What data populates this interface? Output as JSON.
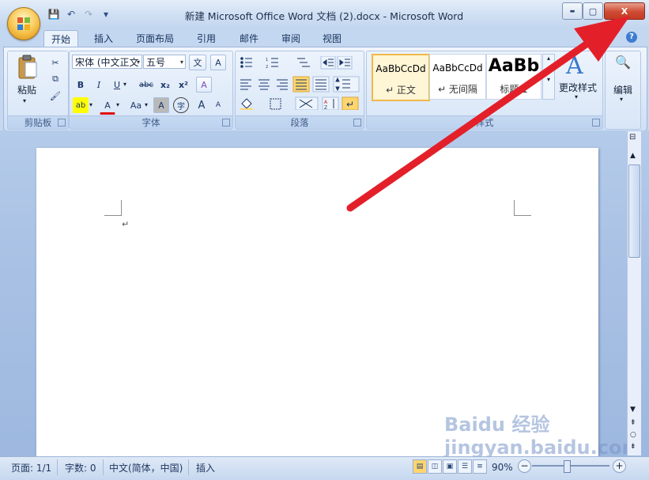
{
  "window": {
    "title": "新建 Microsoft Office Word 文档 (2).docx - Microsoft Word",
    "minimize_symbol": "▬",
    "maximize_symbol": "▢",
    "close_symbol": "X"
  },
  "quick_access": {
    "save_symbol": "💾",
    "undo_symbol": "↶",
    "redo_symbol": "↷",
    "customize_symbol": "▾"
  },
  "tabs": [
    "开始",
    "插入",
    "页面布局",
    "引用",
    "邮件",
    "审阅",
    "视图"
  ],
  "help_symbol": "?",
  "ribbon": {
    "clipboard": {
      "label": "剪贴板",
      "paste_label": "粘贴",
      "cut_symbol": "✂",
      "copy_symbol": "⧉",
      "format_painter_symbol": "🖌"
    },
    "font": {
      "label": "字体",
      "font_name": "宋体 (中文正文",
      "font_size": "五号",
      "phonetic_symbol": "文",
      "charborder_symbol": "A",
      "bold": "B",
      "italic": "I",
      "underline": "U",
      "strikethrough": "abc",
      "subscript": "x₂",
      "superscript": "x²",
      "clear_format_symbol": "A",
      "highlight_symbol": "ab",
      "font_color_symbol": "A",
      "case_symbol": "Aa",
      "charshade_symbol": "A",
      "enclose_symbol": "字",
      "grow_symbol": "A",
      "shrink_symbol": "A"
    },
    "paragraph": {
      "label": "段落"
    },
    "styles": {
      "label": "样式",
      "items": [
        {
          "sample": "AaBbCcDd",
          "name": "↵ 正文"
        },
        {
          "sample": "AaBbCcDd",
          "name": "↵ 无间隔"
        },
        {
          "sample": "AaBb",
          "name": "标题 1"
        }
      ],
      "change_styles_label": "更改样式"
    },
    "editing": {
      "label": "编辑",
      "find_symbol": "🔍"
    }
  },
  "document": {
    "paragraph_mark": "↵"
  },
  "statusbar": {
    "page": "页面: 1/1",
    "words": "字数: 0",
    "language": "中文(简体，中国)",
    "mode": "插入",
    "zoom": "90%",
    "zoom_out_symbol": "−",
    "zoom_in_symbol": "+"
  },
  "colors": {
    "title_gradient_top": "#e3edf9",
    "close_red": "#c43b23",
    "arrow_red": "#e3202a",
    "highlight_yellow": "#ffff00",
    "font_red": "#e01010",
    "active_orange": "#ffd66e"
  },
  "watermark": "Baidu 经验 jingyan.baidu.com"
}
